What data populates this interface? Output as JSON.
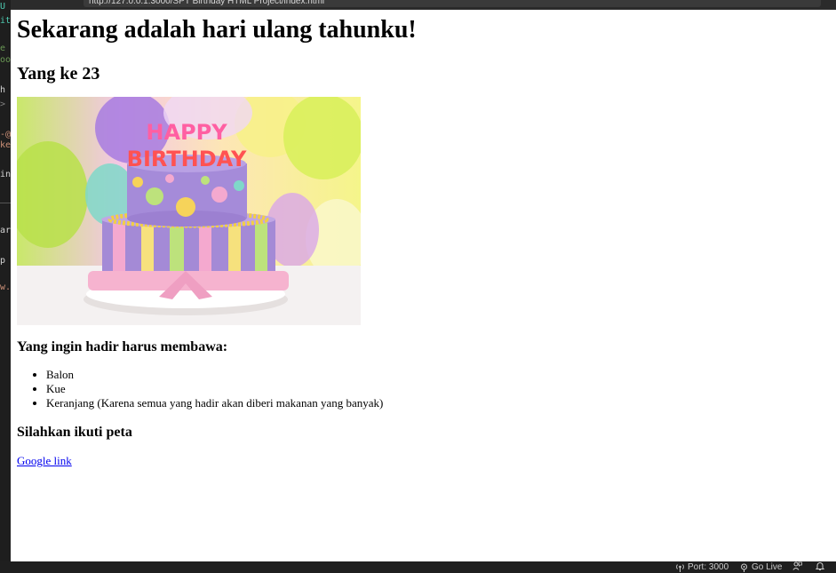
{
  "browser": {
    "url": "http://127.0.0.1:3000/SPT Birthday HTML Project/index.html"
  },
  "editor": {
    "fragments": [
      {
        "text": "U",
        "color": "#4ec9b0"
      },
      {
        "text": "it",
        "color": "#4ec9b0"
      },
      {
        "text": "e",
        "color": "#6a9955"
      },
      {
        "text": "oo",
        "color": "#6a9955"
      },
      {
        "text": "h",
        "color": "#d4d4d4"
      },
      {
        "text": ">",
        "color": "#808080"
      },
      {
        "text": "-@",
        "color": "#ce9178"
      },
      {
        "text": "ke",
        "color": "#ce9178"
      },
      {
        "text": "in",
        "color": "#d4d4d4"
      },
      {
        "text": "ar",
        "color": "#d4d4d4"
      },
      {
        "text": "p",
        "color": "#d4d4d4"
      },
      {
        "text": "w.",
        "color": "#ce9178"
      }
    ]
  },
  "page": {
    "title": "Sekarang adalah hari ulang tahunku!",
    "subtitle": "Yang ke 23",
    "image_alt": "Kue ulang tahun",
    "cake_text_top": "HAPPY",
    "cake_text_bottom": "BIRTHDAY",
    "bring_heading": "Yang ingin hadir harus membawa:",
    "items": [
      "Balon",
      "Kue",
      "Keranjang (Karena semua yang hadir akan diberi makanan yang banyak)"
    ],
    "map_heading": "Silahkan ikuti peta",
    "map_link": "Google link"
  },
  "statusbar": {
    "port": "Port: 3000",
    "go_live": "Go Live"
  }
}
